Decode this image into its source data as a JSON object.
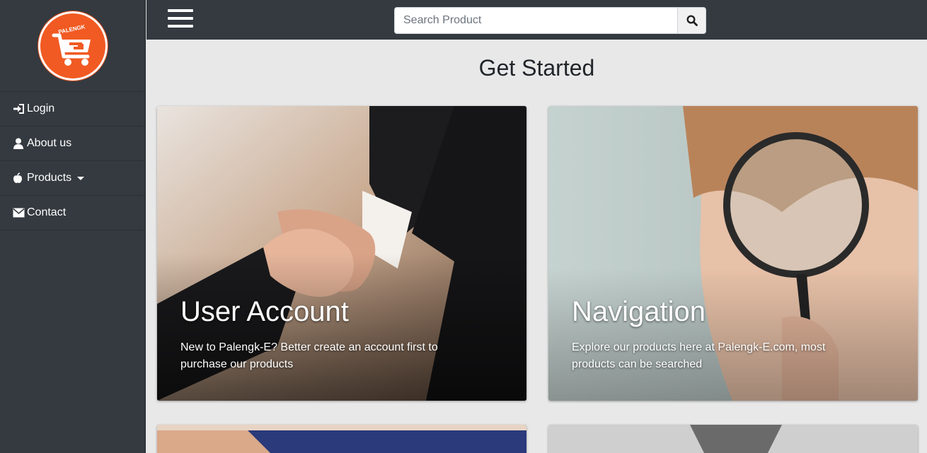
{
  "logo": {
    "text": "PALENGK"
  },
  "sidebar": {
    "items": [
      {
        "label": "Login",
        "icon": "login-icon"
      },
      {
        "label": "About us",
        "icon": "user-icon"
      },
      {
        "label": "Products",
        "icon": "apple-icon",
        "dropdown": true
      },
      {
        "label": "Contact",
        "icon": "envelope-icon"
      }
    ]
  },
  "topbar": {
    "search_placeholder": "Search Product",
    "search_value": ""
  },
  "main": {
    "title": "Get Started",
    "cards": [
      {
        "title": "User Account",
        "description": "New to Palengk-E? Better create an account first to purchase our products"
      },
      {
        "title": "Navigation",
        "description": "Explore our products here at Palengk-E.com, most products can be searched"
      }
    ]
  },
  "colors": {
    "sidebar_bg": "#343a40",
    "page_bg": "#e8e8e8",
    "logo_orange": "#f15a22"
  }
}
